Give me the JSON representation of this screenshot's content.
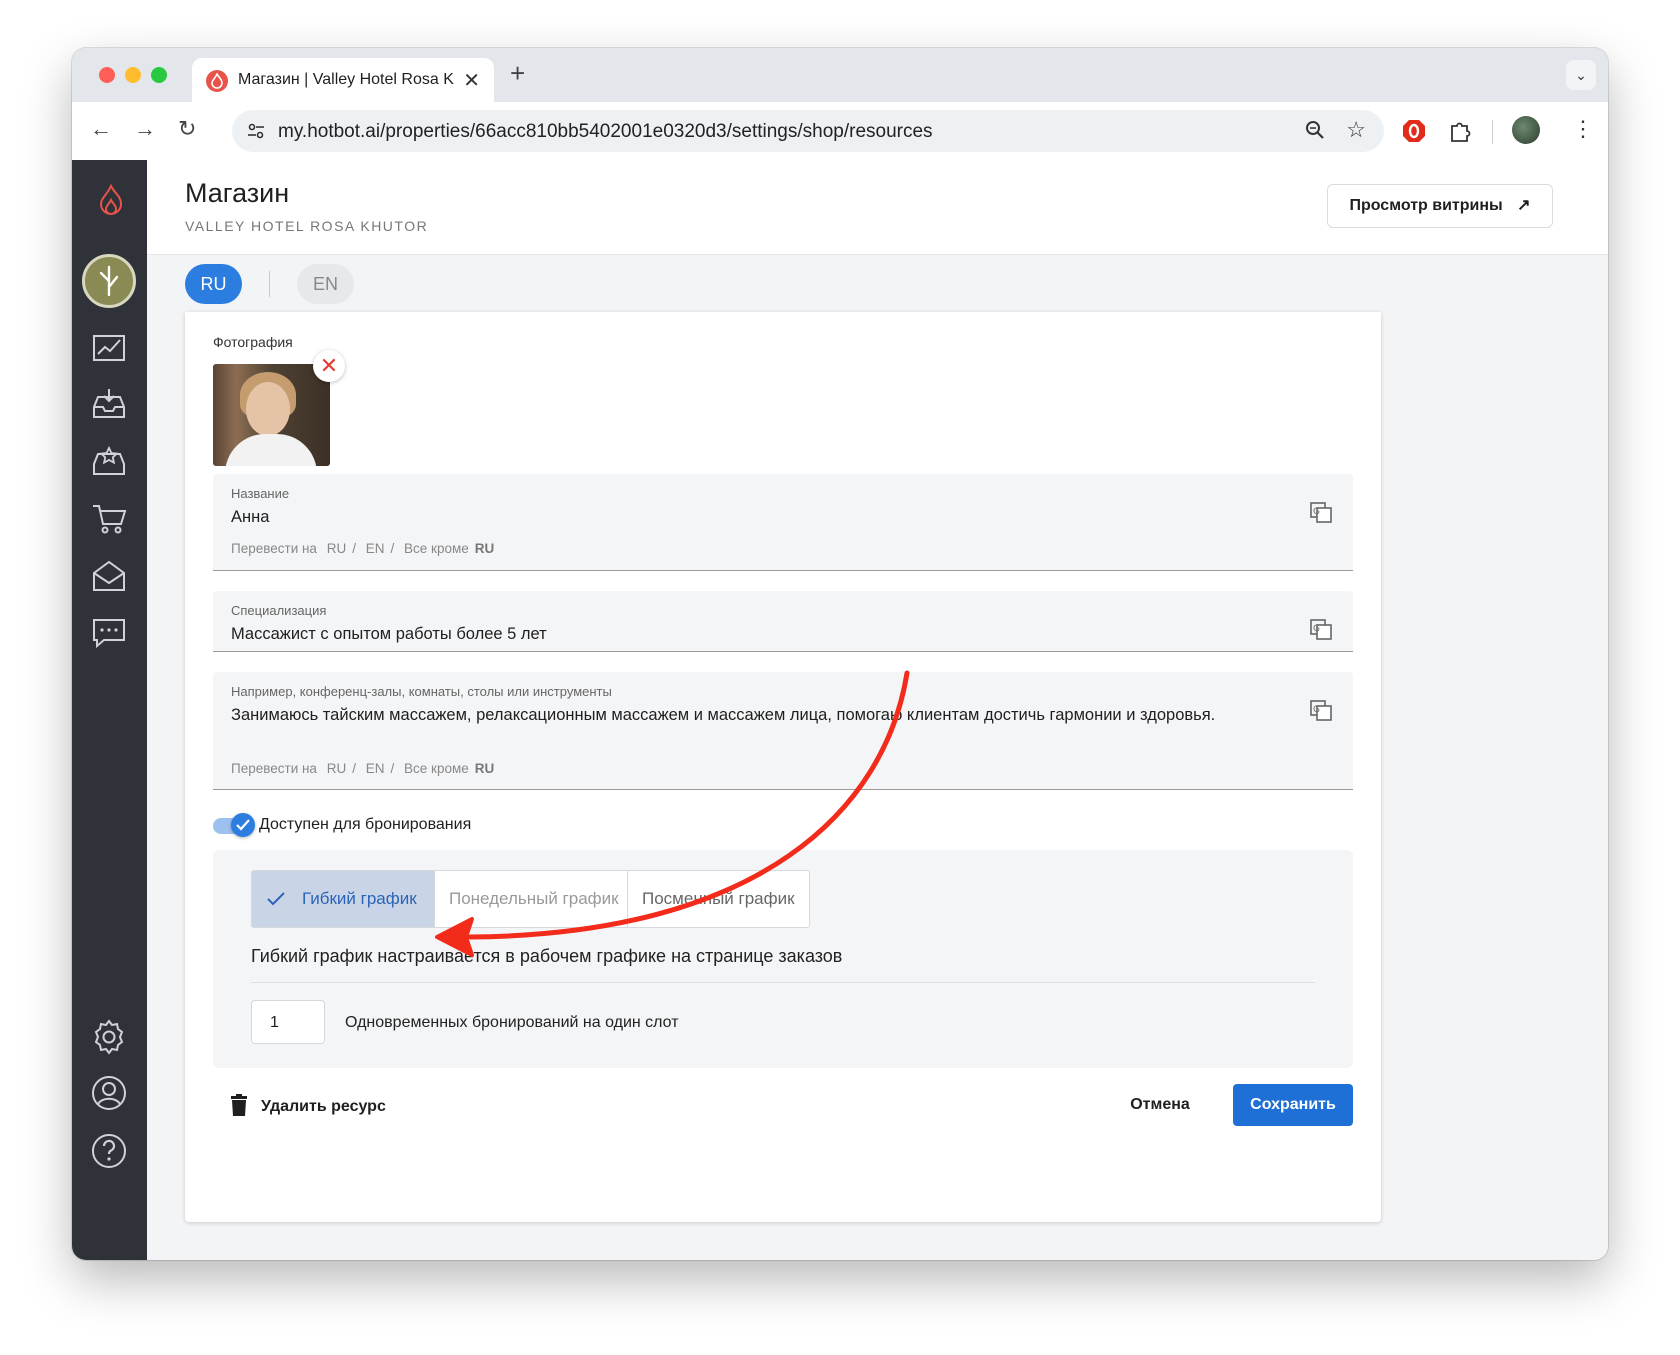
{
  "browser": {
    "tab_title": "Магазин | Valley Hotel Rosa K",
    "url": "my.hotbot.ai/properties/66acc810bb5402001e0320d3/settings/shop/resources"
  },
  "sidebar": {
    "icons": [
      "flame-logo-icon",
      "avatar",
      "analytics-icon",
      "inbox-download-icon",
      "reviews-star-icon",
      "cart-icon",
      "mail-icon",
      "chat-icon",
      "settings-gear-icon",
      "profile-icon",
      "help-icon"
    ]
  },
  "header": {
    "title": "Магазин",
    "subtitle": "VALLEY HOTEL ROSA KHUTOR",
    "storefront_button": "Просмотр витрины"
  },
  "languages": [
    "RU",
    "EN"
  ],
  "form": {
    "photo_label": "Фотография",
    "name": {
      "label": "Название",
      "value": "Анна"
    },
    "specialization": {
      "label": "Специализация",
      "value": "Массажист с опытом работы более 5 лет"
    },
    "description": {
      "label": "Например, конференц-залы, комнаты, столы или инструменты",
      "value": "Занимаюсь тайским массажем, релаксационным массажем и массажем лица, помогаю клиентам достичь гармонии и здоровья."
    },
    "translate": {
      "prefix": "Перевести на",
      "ru": "RU",
      "en": "EN",
      "all_except": "Все кроме",
      "all_except_lang": "RU"
    },
    "available_label": "Доступен для бронирования",
    "available": true,
    "schedule_options": [
      "Гибкий график",
      "Понедельный график",
      "Посменный график"
    ],
    "schedule_selected": "Гибкий график",
    "schedule_description": "Гибкий график настраивается в рабочем графике на странице заказов",
    "slots_value": "1",
    "slots_label": "Одновременных бронирований на один слот",
    "delete_label": "Удалить ресурс",
    "cancel_label": "Отмена",
    "save_label": "Сохранить"
  },
  "colors": {
    "accent": "#1e6fd6",
    "annotation_arrow": "#f22b1b",
    "sidebar": "#2f3238"
  }
}
